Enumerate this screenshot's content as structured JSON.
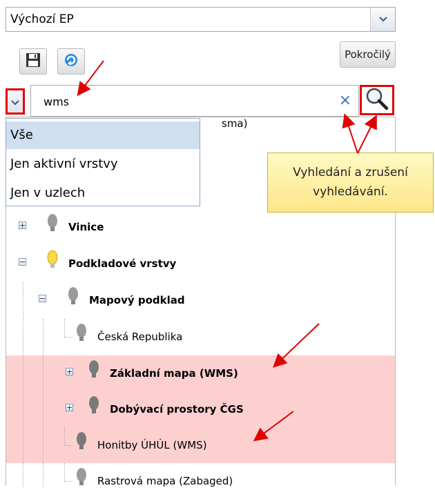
{
  "preset": {
    "value": "Výchozí EP"
  },
  "toolbar": {
    "advanced_label": "Pokročilý"
  },
  "search": {
    "value": "wms",
    "clear_symbol": "×"
  },
  "filter_menu": {
    "options": [
      {
        "label": "Vše",
        "selected": true
      },
      {
        "label": "Jen aktivní vrstvy",
        "selected": false
      },
      {
        "label": "Jen v uzlech",
        "selected": false
      }
    ]
  },
  "tooltip": {
    "text": "Vyhledání a zrušení vyhledávání."
  },
  "tree": {
    "partial_first_label": "sma)",
    "items": [
      {
        "label": "Vinice",
        "bold": true,
        "level": 0,
        "expander": "+",
        "bulb": "gray",
        "highlight": false
      },
      {
        "label": "Podkladové vrstvy",
        "bold": true,
        "level": 0,
        "expander": "-",
        "bulb": "yellow",
        "highlight": false
      },
      {
        "label": "Mapový podklad",
        "bold": true,
        "level": 1,
        "expander": "-",
        "bulb": "gray",
        "highlight": false
      },
      {
        "label": "Česká Republika",
        "bold": false,
        "level": 2,
        "expander": "",
        "bulb": "gray",
        "highlight": false
      },
      {
        "label": "Základní mapa (WMS)",
        "bold": true,
        "level": 2,
        "expander": "+",
        "bulb": "gray-dark",
        "highlight": true
      },
      {
        "label": "Dobývací prostory ČGS",
        "bold": true,
        "level": 2,
        "expander": "+",
        "bulb": "gray-dark",
        "highlight": true
      },
      {
        "label": "Honitby ÚHÚL (WMS)",
        "bold": false,
        "level": 2,
        "expander": "",
        "bulb": "gray-dark",
        "highlight": true
      },
      {
        "label": "Rastrová mapa (Zabaged)",
        "bold": false,
        "level": 2,
        "expander": "",
        "bulb": "gray",
        "highlight": false
      }
    ]
  },
  "colors": {
    "annotation_red": "#e00000",
    "highlight_row": "#fdd0d0",
    "tooltip_bg": "#fde68a",
    "menu_selected": "#cfdff0"
  },
  "icons": [
    "save-icon",
    "refresh-icon",
    "filter-dropdown-icon",
    "search-icon",
    "clear-icon",
    "lightbulb-icon"
  ]
}
